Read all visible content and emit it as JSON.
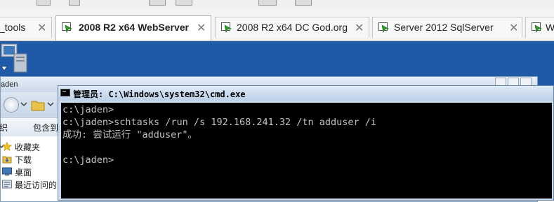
{
  "tabs": [
    {
      "label": "_tools",
      "active": false
    },
    {
      "label": "2008 R2 x64 WebServer",
      "active": true
    },
    {
      "label": "2008 R2 x64 DC God.org",
      "active": false
    },
    {
      "label": "Server 2012 SqlServer",
      "active": false
    },
    {
      "label": "W",
      "active": false
    }
  ],
  "tab_close_glyph": "✕",
  "explorer": {
    "title": "aden",
    "toolbar": {
      "organize": "织",
      "include_in": "包含到"
    },
    "nav_items": [
      {
        "label": "收藏夹",
        "icon": "star-icon"
      },
      {
        "label": "下载",
        "icon": "download-folder-icon"
      },
      {
        "label": "桌面",
        "icon": "desktop-icon"
      },
      {
        "label": "最近访问的",
        "icon": "recent-places-icon"
      }
    ]
  },
  "cmd": {
    "title": "管理员: C:\\Windows\\system32\\cmd.exe",
    "lines": [
      "c:\\jaden>",
      "c:\\jaden>schtasks /run /s 192.168.241.32 /tn adduser /i",
      "成功: 尝试运行 \"adduser\"。",
      "",
      "c:\\jaden>"
    ]
  },
  "colors": {
    "desktop": "#1e5aa8",
    "console_bg": "#000000",
    "console_fg": "#c0c0c0",
    "vm_icon_green": "#2e9c2e"
  }
}
